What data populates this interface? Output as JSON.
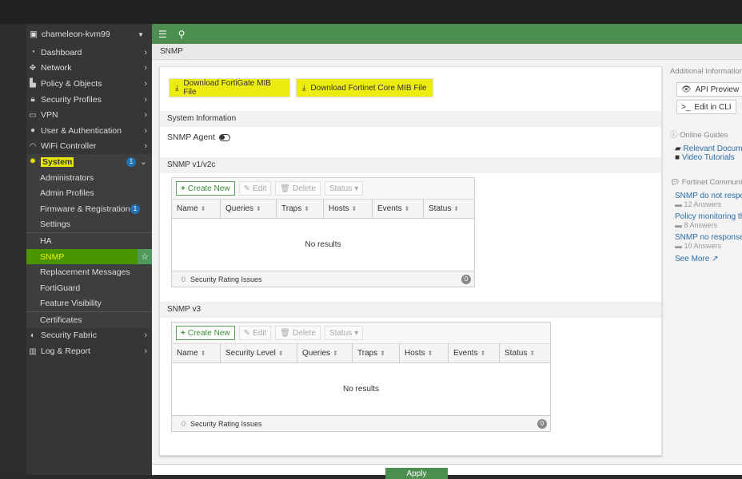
{
  "sidebar": {
    "device": "chameleon-kvm99",
    "items": [
      {
        "label": "Dashboard",
        "icon": "dashboard-icon"
      },
      {
        "label": "Network",
        "icon": "network-icon"
      },
      {
        "label": "Policy & Objects",
        "icon": "policy-icon"
      },
      {
        "label": "Security Profiles",
        "icon": "lock-icon"
      },
      {
        "label": "VPN",
        "icon": "laptop-icon"
      },
      {
        "label": "User & Authentication",
        "icon": "user-icon"
      },
      {
        "label": "WiFi Controller",
        "icon": "wifi-icon"
      }
    ],
    "system": {
      "label": "System",
      "badge": "1"
    },
    "system_sub": [
      "Administrators",
      "Admin Profiles",
      "Firmware & Registration",
      "Settings"
    ],
    "firmware_badge": "1",
    "system_sub2": [
      "HA",
      "SNMP",
      "Replacement Messages",
      "FortiGuard",
      "Feature Visibility"
    ],
    "certificates": "Certificates",
    "bottom": [
      {
        "label": "Security Fabric"
      },
      {
        "label": "Log & Report"
      }
    ]
  },
  "breadcrumb": "SNMP",
  "main": {
    "download_fortigate": "Download FortiGate MIB File",
    "download_core": "Download Fortinet Core MIB File",
    "system_info": "System Information",
    "snmp_agent": "SNMP Agent",
    "v1_title": "SNMP v1/v2c",
    "v3_title": "SNMP v3",
    "toolbar": {
      "create": "Create New",
      "edit": "Edit",
      "delete": "Delete",
      "status": "Status"
    },
    "v1_columns": [
      "Name",
      "Queries",
      "Traps",
      "Hosts",
      "Events",
      "Status"
    ],
    "v3_columns": [
      "Name",
      "Security Level",
      "Queries",
      "Traps",
      "Hosts",
      "Events",
      "Status"
    ],
    "no_results": "No results",
    "rating_count": "0",
    "rating_label": "Security Rating Issues",
    "rating_badge": "0",
    "apply": "Apply"
  },
  "right": {
    "title": "Additional Information",
    "api_preview": "API Preview",
    "edit_cli": "Edit in CLI",
    "online_guides": "Online Guides",
    "relevant_docs": "Relevant Documentation",
    "video_tutorials": "Video Tutorials",
    "community": "Fortinet Community",
    "posts": [
      {
        "title": "SNMP do not respond",
        "answers": "12 Answers"
      },
      {
        "title": "Policy monitoring through SNMP",
        "answers": "8 Answers"
      },
      {
        "title": "SNMP no response:",
        "answers": "10 Answers"
      }
    ],
    "see_more": "See More"
  }
}
